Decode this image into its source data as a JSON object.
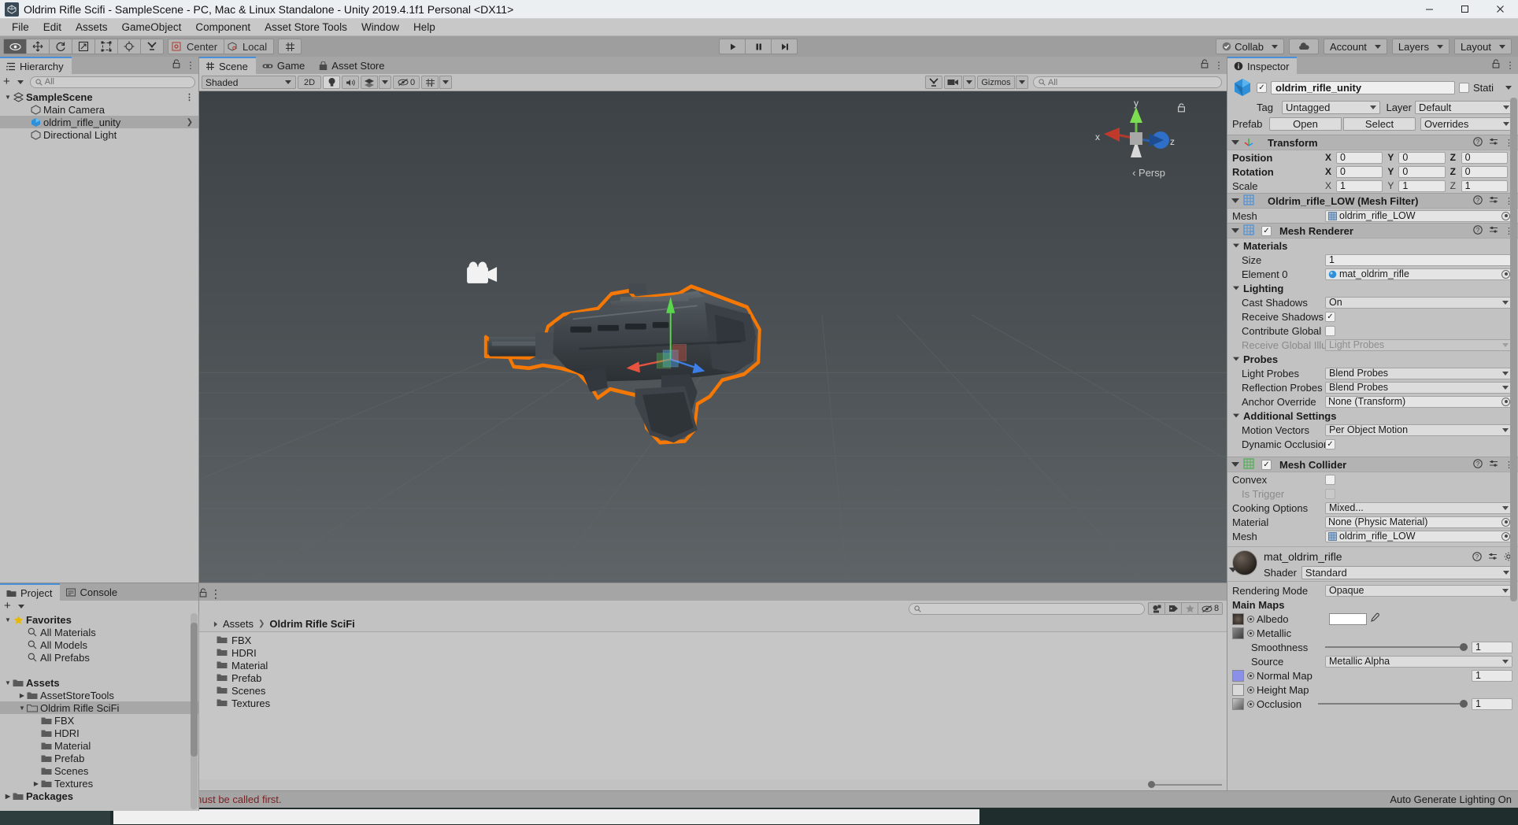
{
  "window": {
    "title": "Oldrim Rifle Scifi - SampleScene - PC, Mac & Linux Standalone - Unity 2019.4.1f1 Personal <DX11>",
    "app_icon": "unity-icon",
    "minimize": "─",
    "maximize": "☐",
    "close": "✕"
  },
  "menubar": {
    "items": [
      "File",
      "Edit",
      "Assets",
      "GameObject",
      "Component",
      "Asset Store Tools",
      "Window",
      "Help"
    ]
  },
  "toolbar": {
    "tools": [
      {
        "name": "hand-tool",
        "glyph": "✋"
      },
      {
        "name": "move-tool",
        "glyph": "✥"
      },
      {
        "name": "rotate-tool",
        "glyph": "↻"
      },
      {
        "name": "scale-tool",
        "glyph": "⬚"
      },
      {
        "name": "rect-tool",
        "glyph": "⬜"
      },
      {
        "name": "transform-tool",
        "glyph": "❂"
      },
      {
        "name": "custom-tool",
        "glyph": "⚒"
      }
    ],
    "pivot_mode": "Center",
    "pivot_rotation": "Local",
    "play": "▶",
    "pause": "❙❙",
    "step": "▶❘",
    "collab": "Collab",
    "cloud": "cloud-icon",
    "account": "Account",
    "layers": "Layers",
    "layout": "Layout"
  },
  "hierarchy": {
    "tab": "Hierarchy",
    "search_placeholder": "All",
    "rows": [
      {
        "label": "SampleScene",
        "indent": 0,
        "icon": "scene-icon",
        "bold": true,
        "twisty": "down",
        "menu": true,
        "selected": false
      },
      {
        "label": "Main Camera",
        "indent": 1,
        "icon": "gameobject-icon",
        "bold": false,
        "twisty": "",
        "menu": false,
        "selected": false
      },
      {
        "label": "oldrim_rifle_unity",
        "indent": 1,
        "icon": "prefab-icon",
        "bold": false,
        "twisty": "",
        "menu": false,
        "selected": true,
        "arrow": true
      },
      {
        "label": "Directional Light",
        "indent": 1,
        "icon": "gameobject-icon",
        "bold": false,
        "twisty": "",
        "menu": false,
        "selected": false
      }
    ]
  },
  "scene": {
    "tabs": [
      {
        "label": "Scene",
        "icon": "scene-grid-icon",
        "active": true
      },
      {
        "label": "Game",
        "icon": "gamepad-icon",
        "active": false
      },
      {
        "label": "Asset Store",
        "icon": "store-icon",
        "active": false
      }
    ],
    "draw_mode": "Shaded",
    "mode_2d": "2D",
    "lighting_icon": "lightbulb-icon",
    "audio_icon": "speaker-icon",
    "fx_icon": "fx-icon",
    "hidden_count": "0",
    "grid_icon": "grid-visibility-icon",
    "tools_icon": "scene-tools-icon",
    "camera_icon": "scene-camera-icon",
    "gizmos": "Gizmos",
    "gizmo_search_placeholder": "All",
    "axis_labels": {
      "x": "x",
      "y": "y",
      "z": "z"
    },
    "projection": "Persp",
    "lock_icon": "lock-icon"
  },
  "project": {
    "tabs": [
      {
        "label": "Project",
        "icon": "folder-icon",
        "active": true
      },
      {
        "label": "Console",
        "icon": "console-icon",
        "active": false
      }
    ],
    "search_placeholder": "",
    "filter_icons": [
      "asset-type-filter-icon",
      "label-filter-icon",
      "favorite-filter-icon"
    ],
    "hidden_count": "8",
    "tree": [
      {
        "label": "Favorites",
        "indent": 0,
        "icon": "star-icon",
        "bold": true,
        "twisty": "down"
      },
      {
        "label": "All Materials",
        "indent": 1,
        "icon": "search-icon",
        "bold": false,
        "twisty": ""
      },
      {
        "label": "All Models",
        "indent": 1,
        "icon": "search-icon",
        "bold": false,
        "twisty": ""
      },
      {
        "label": "All Prefabs",
        "indent": 1,
        "icon": "search-icon",
        "bold": false,
        "twisty": ""
      },
      {
        "label": "",
        "indent": 0,
        "icon": "",
        "bold": false,
        "twisty": ""
      },
      {
        "label": "Assets",
        "indent": 0,
        "icon": "folder-icon",
        "bold": true,
        "twisty": "down"
      },
      {
        "label": "AssetStoreTools",
        "indent": 1,
        "icon": "folder-icon",
        "bold": false,
        "twisty": "right"
      },
      {
        "label": "Oldrim Rifle SciFi",
        "indent": 1,
        "icon": "folder-open-icon",
        "bold": false,
        "twisty": "down",
        "selected": true
      },
      {
        "label": "FBX",
        "indent": 2,
        "icon": "folder-icon",
        "bold": false,
        "twisty": ""
      },
      {
        "label": "HDRI",
        "indent": 2,
        "icon": "folder-icon",
        "bold": false,
        "twisty": ""
      },
      {
        "label": "Material",
        "indent": 2,
        "icon": "folder-icon",
        "bold": false,
        "twisty": ""
      },
      {
        "label": "Prefab",
        "indent": 2,
        "icon": "folder-icon",
        "bold": false,
        "twisty": ""
      },
      {
        "label": "Scenes",
        "indent": 2,
        "icon": "folder-icon",
        "bold": false,
        "twisty": ""
      },
      {
        "label": "Textures",
        "indent": 2,
        "icon": "folder-icon",
        "bold": false,
        "twisty": "right"
      },
      {
        "label": "Packages",
        "indent": 0,
        "icon": "folder-icon",
        "bold": true,
        "twisty": "right"
      }
    ],
    "breadcrumb": [
      {
        "label": "Assets",
        "bold": false
      },
      {
        "label": "Oldrim Rifle SciFi",
        "bold": true
      }
    ],
    "items": [
      "FBX",
      "HDRI",
      "Material",
      "Prefab",
      "Scenes",
      "Textures"
    ]
  },
  "inspector": {
    "tab": "Inspector",
    "object_name": "oldrim_rifle_unity",
    "enabled": true,
    "static_label": "Stati",
    "tag_label": "Tag",
    "tag_value": "Untagged",
    "layer_label": "Layer",
    "layer_value": "Default",
    "prefab_label": "Prefab",
    "prefab_open": "Open",
    "prefab_select": "Select",
    "prefab_overrides": "Overrides",
    "transform": {
      "title": "Transform",
      "rows": [
        {
          "label": "Position",
          "x": "0",
          "y": "0",
          "z": "0",
          "bold": true
        },
        {
          "label": "Rotation",
          "x": "0",
          "y": "0",
          "z": "0",
          "bold": true
        },
        {
          "label": "Scale",
          "x": "1",
          "y": "1",
          "z": "1",
          "bold": false
        }
      ]
    },
    "mesh_filter": {
      "title": "Oldrim_rifle_LOW (Mesh Filter)",
      "mesh_label": "Mesh",
      "mesh_value": "oldrim_rifle_LOW"
    },
    "mesh_renderer": {
      "title": "Mesh Renderer",
      "enabled": true,
      "materials_label": "Materials",
      "size_label": "Size",
      "size_value": "1",
      "element0_label": "Element 0",
      "element0_value": "mat_oldrim_rifle",
      "lighting_label": "Lighting",
      "cast_shadows_label": "Cast Shadows",
      "cast_shadows_value": "On",
      "receive_shadows_label": "Receive Shadows",
      "receive_shadows_checked": true,
      "contribute_gi_label": "Contribute Global Illu",
      "contribute_gi_checked": false,
      "receive_gi_label": "Receive Global Illum",
      "receive_gi_value": "Light Probes",
      "probes_label": "Probes",
      "light_probes_label": "Light Probes",
      "light_probes_value": "Blend Probes",
      "reflection_probes_label": "Reflection Probes",
      "reflection_probes_value": "Blend Probes",
      "anchor_label": "Anchor Override",
      "anchor_value": "None (Transform)",
      "additional_label": "Additional Settings",
      "motion_vectors_label": "Motion Vectors",
      "motion_vectors_value": "Per Object Motion",
      "dynamic_occlusion_label": "Dynamic Occlusion",
      "dynamic_occlusion_checked": true
    },
    "mesh_collider": {
      "title": "Mesh Collider",
      "enabled": true,
      "convex_label": "Convex",
      "convex_checked": false,
      "is_trigger_label": "Is Trigger",
      "is_trigger_checked": false,
      "cooking_label": "Cooking Options",
      "cooking_value": "Mixed...",
      "material_label": "Material",
      "material_value": "None (Physic Material)",
      "mesh_label": "Mesh",
      "mesh_value": "oldrim_rifle_LOW"
    },
    "material": {
      "title": "mat_oldrim_rifle",
      "shader_label": "Shader",
      "shader_value": "Standard",
      "rendering_mode_label": "Rendering Mode",
      "rendering_mode_value": "Opaque",
      "main_maps_label": "Main Maps",
      "albedo_label": "Albedo",
      "metallic_label": "Metallic",
      "smoothness_label": "Smoothness",
      "smoothness_value": "1",
      "source_label": "Source",
      "source_value": "Metallic Alpha",
      "normal_map_label": "Normal Map",
      "normal_map_value": "1",
      "height_map_label": "Height Map",
      "occlusion_label": "Occlusion",
      "occlusion_value": "1"
    }
  },
  "statusbar": {
    "error_icon": "error-icon",
    "error_text": "EndLayoutGroup: BeginLayoutGroup must be called first.",
    "lighting_text": "Auto Generate Lighting On"
  },
  "colors": {
    "selection_outline": "#ff7a00",
    "accent_blue": "#4a90d9",
    "panel_bg": "#c2c2c2",
    "header_bg": "#b3b3b3",
    "viewport_bg": "#4a5053",
    "error_red": "#c62828"
  }
}
